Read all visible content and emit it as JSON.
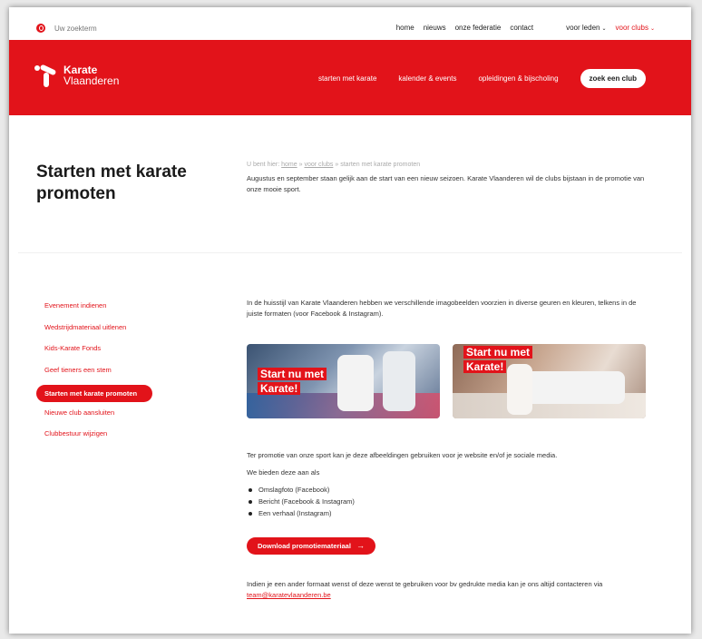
{
  "topbar": {
    "search_placeholder": "Uw zoekterm",
    "links": {
      "home": "home",
      "nieuws": "nieuws",
      "federatie": "onze federatie",
      "contact": "contact",
      "voor_leden": "voor leden",
      "voor_clubs": "voor clubs"
    }
  },
  "header": {
    "logo_line1": "Karate",
    "logo_line2": "Vlaanderen",
    "nav": {
      "starten": "starten met karate",
      "kalender": "kalender & events",
      "opleidingen": "opleidingen & bijscholing",
      "zoek_club": "zoek een club"
    },
    "accent_color": "#e2131a"
  },
  "page": {
    "title": "Starten met karate promoten",
    "breadcrumb": {
      "prefix": "U bent hier:",
      "home": "home",
      "sep": "»",
      "voor_clubs": "voor clubs",
      "current": "starten met karate promoten"
    },
    "intro": "Augustus en september staan gelijk aan de start van een nieuw seizoen. Karate Vlaanderen wil de clubs bijstaan in de promotie van onze mooie sport."
  },
  "sidebar": {
    "items": [
      {
        "label": "Evenement indienen"
      },
      {
        "label": "Wedstrijdmateriaal uitlenen"
      },
      {
        "label": "Kids-Karate Fonds"
      },
      {
        "label": "Geef tieners een stem"
      },
      {
        "label": "Starten met karate promoten"
      },
      {
        "label": "Nieuwe club aansluiten"
      },
      {
        "label": "Clubbestuur wijzigen"
      }
    ]
  },
  "content": {
    "p1": "In de huisstijl van Karate Vlaanderen hebben we verschillende imagobeelden voorzien in diverse geuren en kleuren, telkens in de juiste formaten (voor Facebook & Instagram).",
    "promo_a": {
      "line1": "Start nu met",
      "line2": "Karate!"
    },
    "promo_b": {
      "line1": "Start nu met",
      "line2": "Karate!"
    },
    "p2": "Ter promotie van onze sport kan je deze afbeeldingen gebruiken voor je website en/of je sociale media.",
    "p3": "We bieden deze aan als",
    "bullets": [
      "Omslagfoto (Facebook)",
      "Bericht (Facebook & Instagram)",
      "Een verhaal (Instagram)"
    ],
    "download_label": "Download promotiemateriaal",
    "p4": "Indien je een ander formaat wenst of deze wenst te gebruiken voor bv gedrukte media kan je ons altijd contacteren via",
    "email": "team@karatevlaanderen.be"
  }
}
